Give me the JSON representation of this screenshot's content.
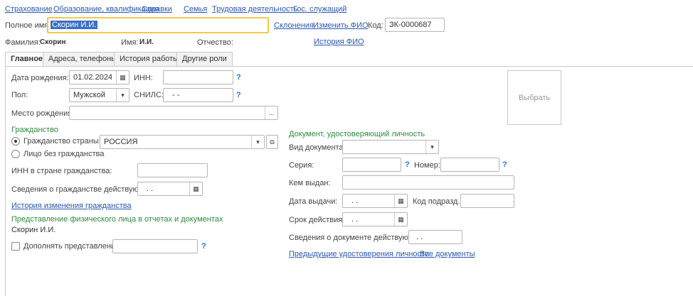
{
  "top_menu": [
    "Страхование",
    "Образование, квалификация",
    "Справки",
    "Семья",
    "Трудовая деятельность",
    "Гос. служащий"
  ],
  "header": {
    "full_name_label": "Полное имя:",
    "full_name_value": "Скорин И.И.",
    "declension_link": "Склонения",
    "change_fio_link": "Изменить ФИО",
    "code_label": "Код:",
    "code_value": "ЗК-0000687",
    "surname_label": "Фамилия:",
    "surname_value": "Скорин",
    "name_label": "Имя:",
    "name_value": "И.И.",
    "patronymic_label": "Отчество:",
    "history_fio_link": "История ФИО"
  },
  "tabs": [
    "Главное",
    "Адреса, телефоны",
    "История работы",
    "Другие роли"
  ],
  "main": {
    "birth_date_label": "Дата рождения:",
    "birth_date_value": "01.02.2024",
    "inn_label": "ИНН:",
    "gender_label": "Пол:",
    "gender_value": "Мужской",
    "snils_label": "СНИЛС:",
    "snils_value": "-   -",
    "birthplace_label": "Место рождения:",
    "birthplace_btn": "...",
    "photo_label": "Выбрать",
    "citizenship_title": "Гражданство",
    "citizenship_country_label": "Гражданство страны:",
    "citizenship_country_value": "РОССИЯ",
    "stateless_label": "Лицо без гражданства",
    "inn_country_label": "ИНН в стране гражданства:",
    "citizenship_valid_label": "Сведения о гражданстве действуют с:",
    "citizenship_valid_value": ".  .",
    "citizenship_history_link": "История изменения гражданства",
    "representation_title": "Представление физического лица в отчетах и документах",
    "representation_value": "Скорин И.И.",
    "supplement_label": "Дополнять представление",
    "q": "?"
  },
  "identity_doc": {
    "title": "Документ, удостоверяющий личность",
    "doc_type_label": "Вид документа:",
    "series_label": "Серия:",
    "number_label": "Номер:",
    "issued_by_label": "Кем выдан:",
    "issue_date_label": "Дата выдачи:",
    "issue_date_value": ".  .",
    "dept_code_label": "Код подразд.:",
    "validity_label": "Срок действия:",
    "validity_value": ".  .",
    "valid_from_label": "Сведения о документе действуют с:",
    "valid_from_value": ".  .",
    "prev_docs_link": "Предыдущие удостоверения личности",
    "all_docs_link": "Все документы"
  }
}
